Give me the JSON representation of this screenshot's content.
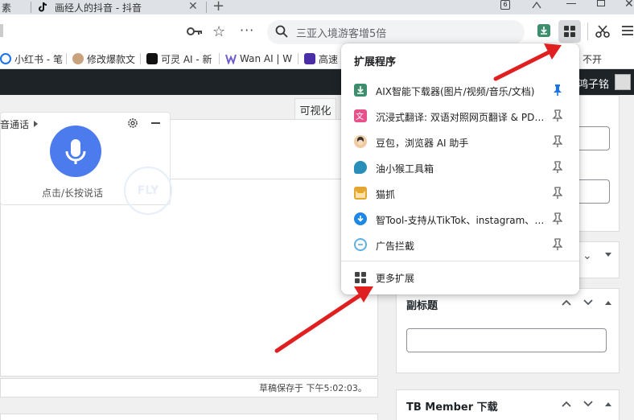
{
  "tabs": [
    {
      "label": "素"
    },
    {
      "label": "画经人的抖音 - 抖音"
    }
  ],
  "omnibox": {
    "text": "三亚入境游客增5倍"
  },
  "bookmarks": [
    {
      "label": "小红书 - 笔",
      "icon": "xiaohongshu-icon",
      "color": "#ff2442"
    },
    {
      "label": "修改爆款文",
      "icon": "avatar-icon",
      "color": "#c9a27e"
    },
    {
      "label": "可灵 AI - 新",
      "icon": "kling-icon",
      "color": "#111111"
    },
    {
      "label": "Wan AI | W",
      "icon": "wan-icon",
      "color": "#6d5bd0"
    },
    {
      "label": "高速",
      "icon": "folder-icon",
      "color": "#4a2ea8"
    },
    {
      "label": "不开",
      "icon": "",
      "color": ""
    }
  ],
  "admin": {
    "user": "鸿子铭"
  },
  "editor": {
    "visual_tab": "可视化",
    "status": "草稿保存于 下午5:02:03。"
  },
  "voice": {
    "title": "音通话",
    "caption": "点击/长按说话",
    "badge": "FLY"
  },
  "sidebar": {
    "subtitle_title": "副标题",
    "tb_title": "TB Member 下载"
  },
  "popup": {
    "title": "扩展程序",
    "extensions": [
      {
        "label": "AIX智能下载器(图片/视频/音乐/文档)",
        "icon": "download-icon",
        "color": "#3e8e6e",
        "pinned": true
      },
      {
        "label": "沉浸式翻译: 双语对照网页翻译 & PDF文档翻译",
        "icon": "translate-icon",
        "color": "#e8508b",
        "pinned": false
      },
      {
        "label": "豆包，浏览器 AI 助手",
        "icon": "doubao-icon",
        "color": "#f2c9a0",
        "pinned": false
      },
      {
        "label": "油小猴工具箱",
        "icon": "monkey-icon",
        "color": "#2a8fb8",
        "pinned": false
      },
      {
        "label": "猫抓",
        "icon": "cat-icon",
        "color": "#e3a72f",
        "pinned": false
      },
      {
        "label": "智Tool-支持从TikTok、instagram、Facebook下载",
        "icon": "zhitool-icon",
        "color": "#1e88e5",
        "pinned": false
      },
      {
        "label": "广告拦截",
        "icon": "adblock-icon",
        "color": "#5fb0e0",
        "pinned": false
      }
    ],
    "more_label": "更多扩展"
  },
  "colors": {
    "arrow": "#e02020",
    "admin_bar": "#1d2327",
    "mic": "#4b7bec",
    "pin_active": "#1a73e8"
  }
}
